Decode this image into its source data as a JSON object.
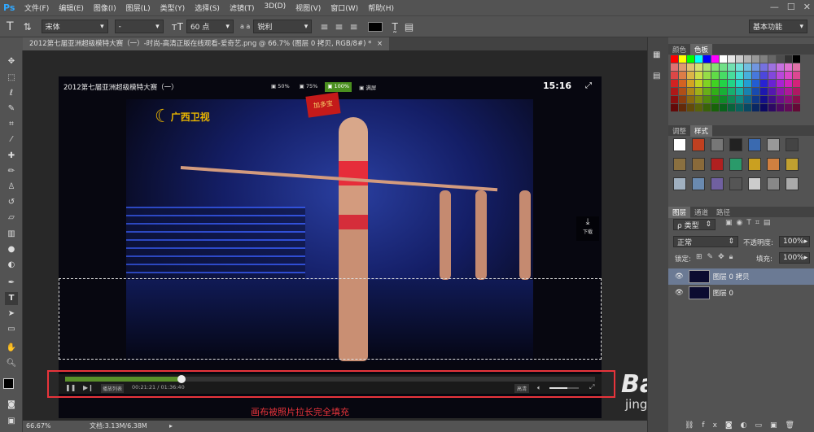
{
  "menubar": {
    "logo": "Ps",
    "items": [
      "文件(F)",
      "编辑(E)",
      "图像(I)",
      "图层(L)",
      "类型(Y)",
      "选择(S)",
      "滤镜(T)",
      "3D(D)",
      "视图(V)",
      "窗口(W)",
      "帮助(H)"
    ]
  },
  "options": {
    "font_family": "宋体",
    "font_style": "-",
    "font_size": "60 点",
    "aa_mode": "锐利",
    "workspace": "基本功能",
    "aa_prefix": "a a"
  },
  "doc_tab": "2012第七届亚洲超级模特大赛（一）-时尚-高清正版在线观看-爱奇艺.png @ 66.7% (图层 0 拷贝, RGB/8#) *",
  "video": {
    "title": "2012第七届亚洲超级模特大赛（一）",
    "zoom_options": [
      "50%",
      "75%",
      "100%",
      "满屏"
    ],
    "clock": "15:16",
    "channel": "广西卫视",
    "sign": "加多宝",
    "download": "下载",
    "playlist": "播放列表",
    "time": "00:21:21 / 01:36:40",
    "quality": "高清",
    "progress": 0.22,
    "volume": 0.6
  },
  "annotation": "画布被照片拉长完全填充",
  "watermark": {
    "brand": "Baidu经验",
    "url": "jingyan.baidu.com"
  },
  "status": {
    "zoom": "66.67%",
    "doc": "文档:3.13M/6.38M"
  },
  "panels": {
    "swatch_tabs": [
      "颜色",
      "色板"
    ],
    "style_tabs": [
      "调整",
      "样式"
    ],
    "layer_tabs": [
      "图层",
      "通道",
      "路径"
    ],
    "kind": "类型",
    "blend_mode": "正常",
    "opacity_label": "不透明度:",
    "opacity": "100%",
    "lock_label": "锁定:",
    "fill_label": "填充:",
    "fill": "100%",
    "layers": [
      "图层 0 拷贝",
      "图层 0"
    ]
  },
  "colors": {
    "annotation_red": "#e8343b",
    "accent_green": "#4a8f1f",
    "selected_layer": "#6b7a94"
  }
}
